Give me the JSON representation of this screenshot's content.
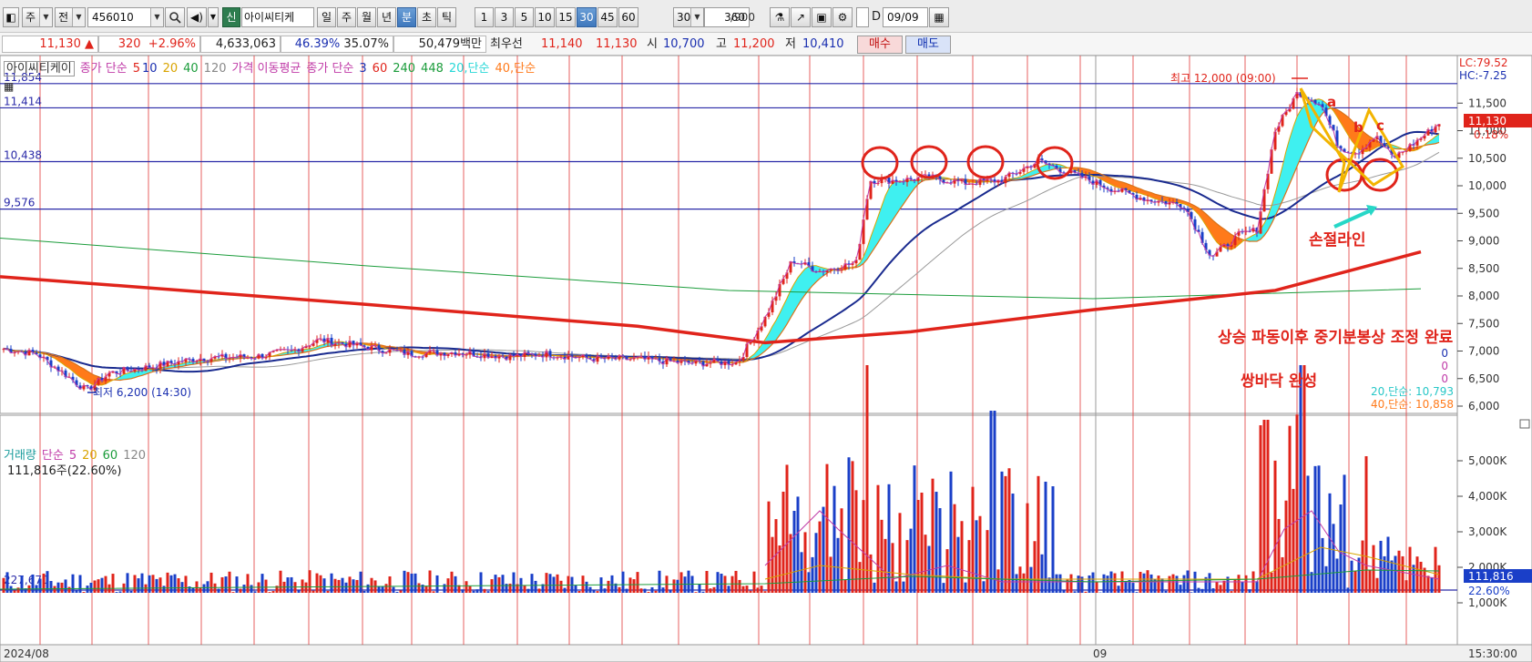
{
  "toolbar": {
    "period_select": "주",
    "prev_button": "전",
    "stock_code": "456010",
    "new_badge": "신",
    "stock_name": "아이씨티케",
    "period_tabs": [
      "일",
      "주",
      "월",
      "년",
      "분",
      "초",
      "틱"
    ],
    "selected_period": "분",
    "intervals": [
      "1",
      "3",
      "5",
      "10",
      "15",
      "30",
      "45",
      "60"
    ],
    "selected_interval": "30",
    "interval_select": "30",
    "count_value": "360",
    "count_max": "/900",
    "d_label": "D",
    "date_value": "09/09"
  },
  "quote": {
    "price": "11,130",
    "direction_icon": "▲",
    "change": "320",
    "change_pct": "+2.96%",
    "volume": "4,633,063",
    "turnover_pct": "46.39%",
    "vol_ratio": "35.07%",
    "amount": "50,479백만",
    "best_label": "최우선",
    "best_ask": "11,140",
    "best_bid": "11,130",
    "open_label": "시",
    "open": "10,700",
    "high_label": "고",
    "high": "11,200",
    "low_label": "저",
    "low": "10,410",
    "buy_button": "매수",
    "sell_button": "매도"
  },
  "price_legend": {
    "name": "아이씨티케이",
    "ma_label": "종가 단순",
    "periods": [
      "5",
      "10",
      "20",
      "40",
      "120"
    ],
    "ma_title": "가격 이동평균",
    "ma2_label": "종가 단순",
    "periods2": [
      "3",
      "60",
      "240",
      "448"
    ],
    "band1": "20,단순",
    "band2": "40,단순"
  },
  "price_axis": {
    "ticks": [
      "11,500",
      "11,000",
      "10,500",
      "10,000",
      "9,500",
      "9,000",
      "8,500",
      "8,000",
      "7,500",
      "7,000",
      "6,500",
      "6,000"
    ],
    "lc": "LC:79.52",
    "hc": "HC:-7.25",
    "current_price": "11,130",
    "current_pct": "0.18%",
    "zeros": [
      "0",
      "0",
      "0"
    ],
    "ma20_value": "20,단순: 10,793",
    "ma40_value": "40,단순: 10,858"
  },
  "levels": {
    "l1": "11,854",
    "l2": "11,414",
    "l3": "10,438",
    "l4": "9,576"
  },
  "annotations": {
    "high": "최고 12,000 (09:00)",
    "low": "최저 6,200 (14:30)",
    "stop_line": "손절라인",
    "note1": "상승 파동이후 중기분봉상 조정 완료",
    "note2": "쌍바닥 완성",
    "wave_a": "a",
    "wave_b": "b",
    "wave_c": "c"
  },
  "volume_panel": {
    "title": "거래량",
    "ma_label": "단순",
    "periods": [
      "5",
      "20",
      "60",
      "120"
    ],
    "current": "111,816주(22.60%)",
    "level": "227,670",
    "ticks": [
      "5,000K",
      "4,000K",
      "3,000K",
      "2,000K",
      "1,000K"
    ],
    "current_value": "111,816",
    "current_pct": "22.60%"
  },
  "time_axis": {
    "start": "2024/08",
    "mid": "09",
    "time": "15:30:00"
  },
  "colors": {
    "up": "#e0241b",
    "down": "#1a3fc8",
    "band": "#3ff0f0",
    "band_down": "#ff7a1a",
    "grid_red": "#e23a3a",
    "level": "#2a2aa8",
    "wave": "#f2b400"
  }
}
